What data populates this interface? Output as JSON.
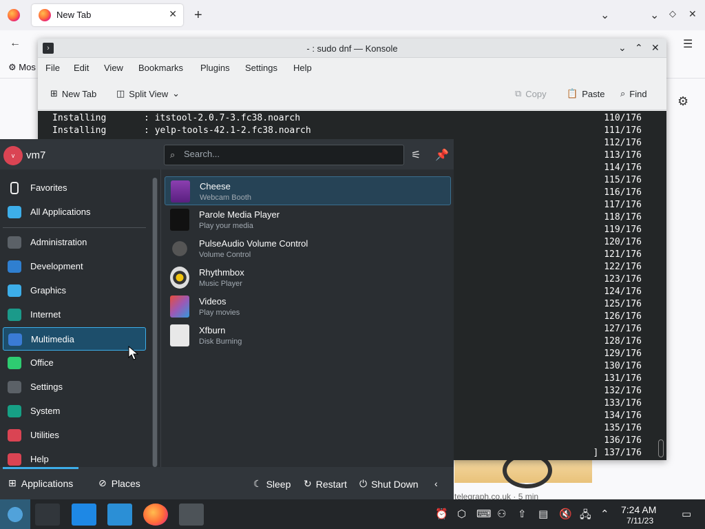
{
  "firefox": {
    "tab_title": "New Tab",
    "bookmark": "Mos",
    "card_text": "telegraph.co.uk · 5 min"
  },
  "konsole": {
    "title": "- : sudo dnf — Konsole",
    "menu": [
      "File",
      "Edit",
      "View",
      "Bookmarks",
      "Plugins",
      "Settings",
      "Help"
    ],
    "toolbar": {
      "new_tab": "New Tab",
      "split_view": "Split View",
      "copy": "Copy",
      "paste": "Paste",
      "find": "Find"
    },
    "lines": [
      "Installing       : itstool-2.0.7-3.fc38.noarch",
      "Installing       : yelp-tools-42.1-2.fc38.noarch"
    ],
    "progress": [
      "110/176",
      "111/176",
      "112/176",
      "113/176",
      "114/176",
      "115/176",
      "116/176",
      "117/176",
      "118/176",
      "119/176",
      "120/176",
      "121/176",
      "122/176",
      "123/176",
      "124/176",
      "125/176",
      "126/176",
      "127/176",
      "128/176",
      "129/176",
      "130/176",
      "131/176",
      "132/176",
      "133/176",
      "134/176",
      "135/176",
      "136/176",
      "] 137/176"
    ]
  },
  "launcher": {
    "user": "vm7",
    "avatar_letter": "v",
    "search_placeholder": "Search...",
    "categories": [
      {
        "label": "Favorites",
        "icon": "bookmark-icon"
      },
      {
        "label": "All Applications",
        "icon": "grid-icon"
      },
      {
        "label": "Administration",
        "icon": "admin-icon"
      },
      {
        "label": "Development",
        "icon": "development-icon"
      },
      {
        "label": "Graphics",
        "icon": "graphics-icon"
      },
      {
        "label": "Internet",
        "icon": "globe-icon"
      },
      {
        "label": "Multimedia",
        "icon": "multimedia-icon"
      },
      {
        "label": "Office",
        "icon": "office-icon"
      },
      {
        "label": "Settings",
        "icon": "settings-icon"
      },
      {
        "label": "System",
        "icon": "system-icon"
      },
      {
        "label": "Utilities",
        "icon": "toolbox-icon"
      },
      {
        "label": "Help",
        "icon": "help-icon"
      }
    ],
    "selected_category": "Multimedia",
    "apps": [
      {
        "name": "Cheese",
        "desc": "Webcam Booth"
      },
      {
        "name": "Parole Media Player",
        "desc": "Play your media"
      },
      {
        "name": "PulseAudio Volume Control",
        "desc": "Volume Control"
      },
      {
        "name": "Rhythmbox",
        "desc": "Music Player"
      },
      {
        "name": "Videos",
        "desc": "Play movies"
      },
      {
        "name": "Xfburn",
        "desc": "Disk Burning"
      }
    ],
    "footer": {
      "applications": "Applications",
      "places": "Places",
      "sleep": "Sleep",
      "restart": "Restart",
      "shutdown": "Shut Down"
    }
  },
  "panel": {
    "time": "7:24 AM",
    "date": "7/11/23"
  },
  "colors": {
    "accent": "#3daee9",
    "launcher_bg": "#2a2e32",
    "terminal_bg": "#232627",
    "panel_bg": "#232629"
  }
}
